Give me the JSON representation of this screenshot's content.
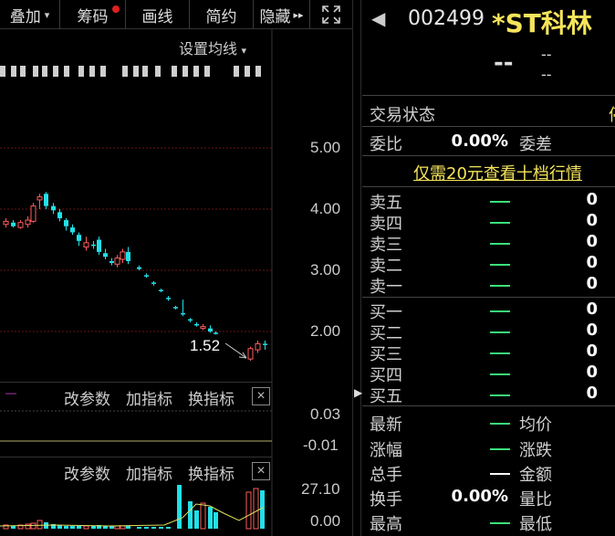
{
  "toolbar": {
    "overlay": "叠加",
    "chips": "筹码",
    "draw": "画线",
    "simple": "简约",
    "hide": "隐藏",
    "more_icon": "double-chevron-right",
    "fullscreen_icon": "fullscreen-expand"
  },
  "chart": {
    "avg_setting": "设置均线",
    "price_axis": [
      "5.00",
      "4.00",
      "3.00",
      "2.00"
    ],
    "low_marker": "1.52",
    "indicator_panel_1": {
      "params": "改参数",
      "add": "加指标",
      "swap": "换指标",
      "axis": [
        "0.03",
        "-0.01"
      ]
    },
    "indicator_panel_2": {
      "params": "改参数",
      "add": "加指标",
      "swap": "换指标",
      "axis": [
        "27.10",
        "0.00"
      ]
    },
    "colors": {
      "up": "#ff5c5c",
      "down": "#22e0e8",
      "grid": "#7a1a1a"
    }
  },
  "quote": {
    "code": "002499",
    "name": "*ST科林",
    "price": "--",
    "change": "--",
    "change_pct": "--",
    "trade_status_label": "交易状态",
    "trade_status_value": "停",
    "ratio_label": "委比",
    "ratio_value": "0.00%",
    "diff_label": "委差",
    "promo": "仅需20元查看十档行情",
    "asks": [
      {
        "label": "卖五",
        "price": "—",
        "vol": "0"
      },
      {
        "label": "卖四",
        "price": "—",
        "vol": "0"
      },
      {
        "label": "卖三",
        "price": "—",
        "vol": "0"
      },
      {
        "label": "卖二",
        "price": "—",
        "vol": "0"
      },
      {
        "label": "卖一",
        "price": "—",
        "vol": "0"
      }
    ],
    "bids": [
      {
        "label": "买一",
        "price": "—",
        "vol": "0"
      },
      {
        "label": "买二",
        "price": "—",
        "vol": "0"
      },
      {
        "label": "买三",
        "price": "—",
        "vol": "0"
      },
      {
        "label": "买四",
        "price": "—",
        "vol": "0"
      },
      {
        "label": "买五",
        "price": "—",
        "vol": "0"
      }
    ],
    "stats": {
      "latest": "最新",
      "avg": "均价",
      "change": "涨幅",
      "updown": "涨跌",
      "total": "总手",
      "amount": "金额",
      "turnover": "换手",
      "turnover_value": "0.00%",
      "vol_ratio": "量比",
      "high": "最高",
      "low": "最低"
    }
  }
}
